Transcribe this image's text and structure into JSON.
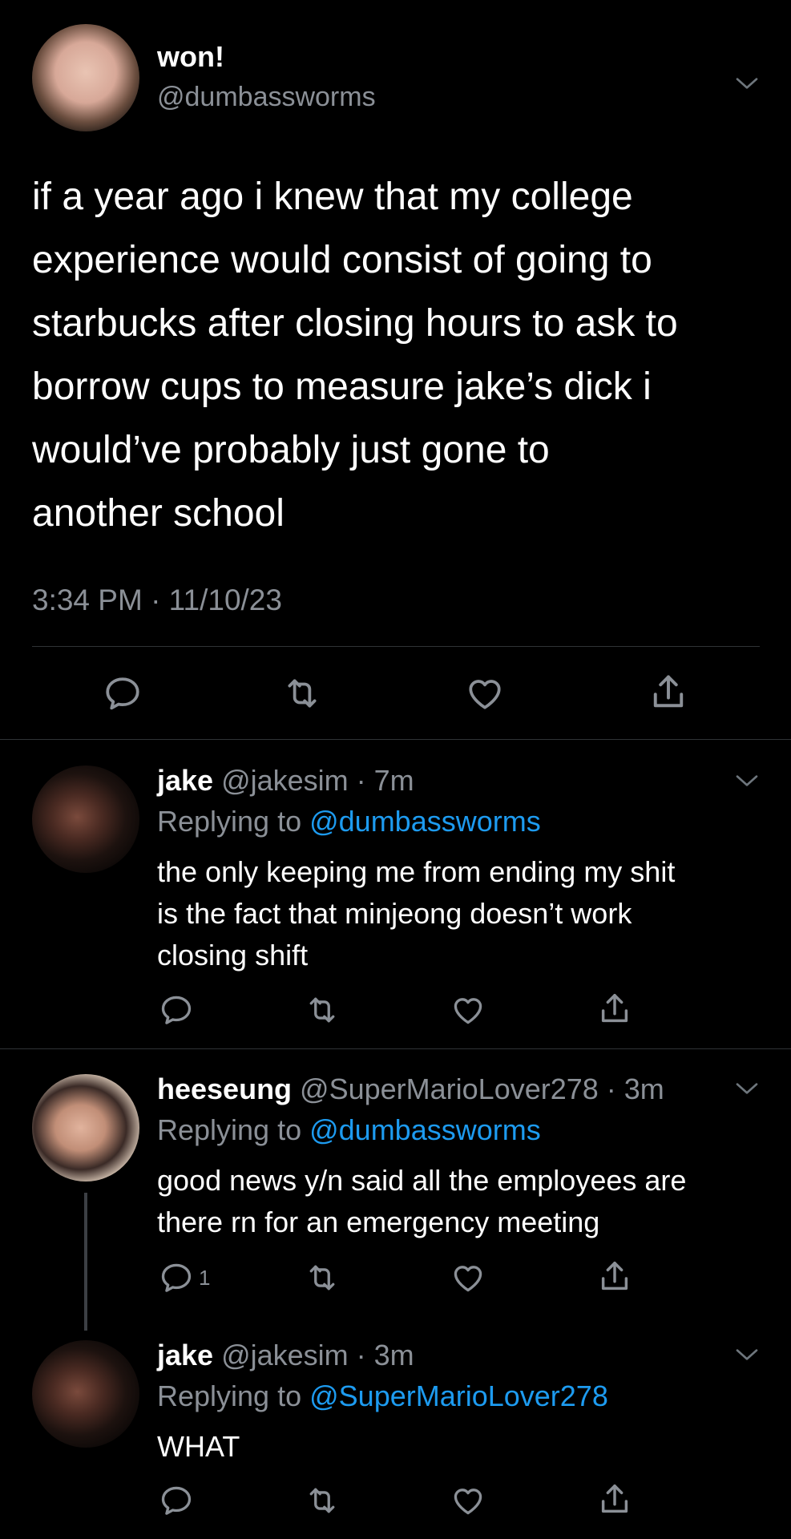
{
  "main_tweet": {
    "name": "won!",
    "handle": "@dumbassworms",
    "text_lines": [
      "if a year ago i knew that my college",
      "experience would consist of going to",
      "starbucks after closing hours to ask to",
      "borrow cups to measure jake’s dick i",
      "would’ve probably just gone to",
      "another school"
    ],
    "timestamp": "3:34 PM · 11/10/23"
  },
  "replies": [
    {
      "name": "jake",
      "meta": " @jakesim · 7m",
      "replying_prefix": "Replying to ",
      "replying_to": "@dumbassworms",
      "text_lines": [
        "the only keeping me from ending my shit",
        "is the fact that minjeong doesn’t work",
        "closing shift"
      ],
      "reply_count": ""
    },
    {
      "name": "heeseung",
      "meta": " @SuperMarioLover278 · 3m",
      "replying_prefix": "Replying to ",
      "replying_to": "@dumbassworms",
      "text_lines": [
        "good news y/n said all the employees are",
        "there rn for an emergency meeting"
      ],
      "reply_count": "1"
    },
    {
      "name": "jake",
      "meta": " @jakesim · 3m",
      "replying_prefix": "Replying to ",
      "replying_to": "@SuperMarioLover278",
      "text_lines": [
        "WHAT"
      ],
      "reply_count": ""
    }
  ],
  "icons": {
    "reply": "reply-icon",
    "retweet": "retweet-icon",
    "like": "like-icon",
    "share": "share-icon",
    "more": "chevron-down-icon"
  },
  "colors": {
    "background": "#000000",
    "text": "#ffffff",
    "secondary_text": "#8b9097",
    "link": "#1d9bf0",
    "divider": "#2f3336"
  }
}
